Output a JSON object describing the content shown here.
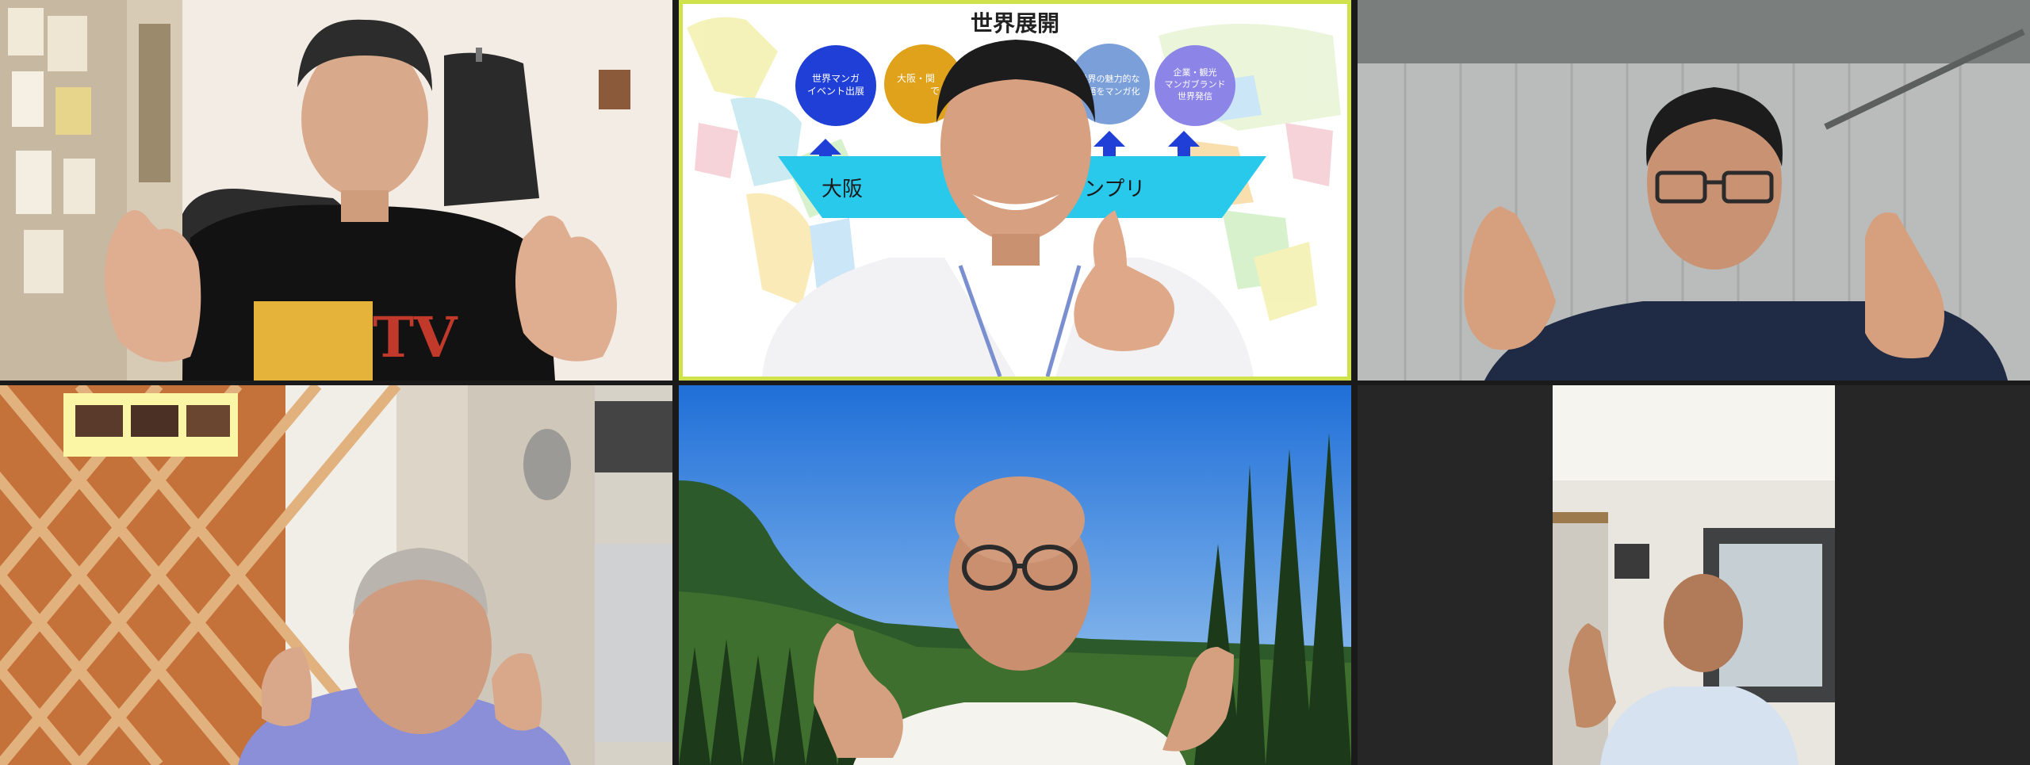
{
  "meeting": {
    "participants": [
      {
        "id": "p1",
        "label": "participant-1"
      },
      {
        "id": "p2",
        "label": "participant-2-speaker"
      },
      {
        "id": "p3",
        "label": "participant-3"
      },
      {
        "id": "p4",
        "label": "participant-4"
      },
      {
        "id": "p5",
        "label": "participant-5"
      },
      {
        "id": "p6",
        "label": "participant-6"
      }
    ],
    "active_speaker_color": "#cfe24b"
  },
  "slide": {
    "title": "世界展開",
    "circles": [
      {
        "line1": "世界マンガ",
        "line2": "イベント出展",
        "line3": "",
        "color": "#1f3fd6"
      },
      {
        "line1": "大阪・関",
        "line2": "で",
        "line3": "",
        "color": "#e0a21a"
      },
      {
        "line1": "",
        "line2": "",
        "line3": "",
        "color": "#8fc33a"
      },
      {
        "line1": "世界の魅力的な",
        "line2": "物語をマンガ化",
        "line3": "",
        "color": "#7b9fd8"
      },
      {
        "line1": "企業・観光",
        "line2": "マンガブランド",
        "line3": "世界発信",
        "color": "#8c84e6"
      }
    ],
    "banner_left": "大阪",
    "banner_right": "ランプリ"
  },
  "shirt_logo": "TV"
}
